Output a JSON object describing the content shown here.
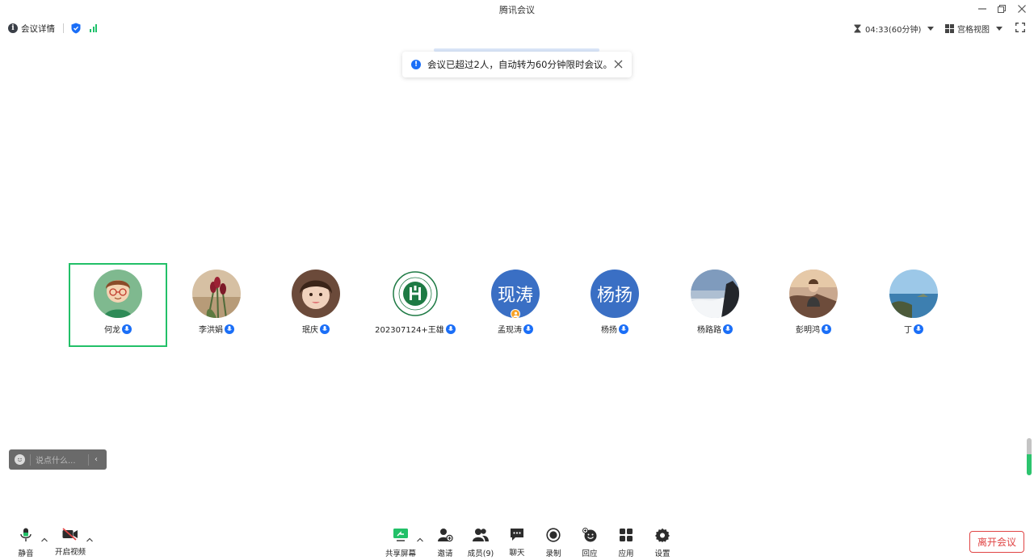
{
  "window": {
    "title": "腾讯会议"
  },
  "infobar": {
    "meeting_info_label": "会议详情",
    "timer": "04:33(60分钟)",
    "view_mode": "宫格视图"
  },
  "toast": {
    "message": "会议已超过2人，自动转为60分钟限时会议。"
  },
  "participants": [
    {
      "name": "何龙",
      "avatar_type": "image",
      "active_speaker": true
    },
    {
      "name": "李洪娟",
      "avatar_type": "image"
    },
    {
      "name": "珉庆",
      "avatar_type": "image"
    },
    {
      "name": "202307124+王雄",
      "avatar_type": "image"
    },
    {
      "name": "孟现涛",
      "avatar_type": "text",
      "avatar_text": "现涛",
      "host": true
    },
    {
      "name": "杨扬",
      "avatar_type": "text",
      "avatar_text": "杨扬"
    },
    {
      "name": "杨路路",
      "avatar_type": "image"
    },
    {
      "name": "彭明鸿",
      "avatar_type": "image"
    },
    {
      "name": "丁",
      "avatar_type": "image"
    }
  ],
  "chat": {
    "placeholder": "说点什么..."
  },
  "toolbar": {
    "mute_label": "静音",
    "video_label": "开启视频",
    "share_label": "共享屏幕",
    "invite_label": "邀请",
    "members_label": "成员(9)",
    "chat_label": "聊天",
    "record_label": "录制",
    "react_label": "回应",
    "apps_label": "应用",
    "settings_label": "设置",
    "leave_label": "离开会议"
  },
  "colors": {
    "accent_blue": "#1a6ef7",
    "speaker_green": "#22c068",
    "leave_red": "#e04444",
    "text_avatar": "#3a6fc4"
  }
}
